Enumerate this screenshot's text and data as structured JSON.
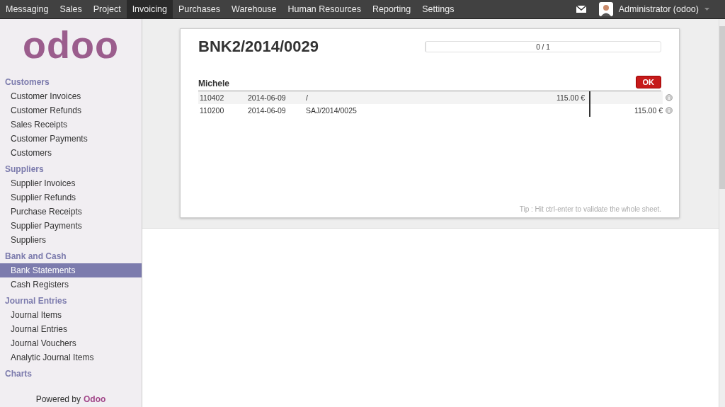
{
  "top_menu": [
    {
      "label": "Messaging",
      "selected": false
    },
    {
      "label": "Sales",
      "selected": false
    },
    {
      "label": "Project",
      "selected": false
    },
    {
      "label": "Invoicing",
      "selected": true
    },
    {
      "label": "Purchases",
      "selected": false
    },
    {
      "label": "Warehouse",
      "selected": false
    },
    {
      "label": "Human Resources",
      "selected": false
    },
    {
      "label": "Reporting",
      "selected": false
    },
    {
      "label": "Settings",
      "selected": false
    }
  ],
  "user": {
    "name": "Administrator (odoo)"
  },
  "logo": "odoo",
  "sidebar": [
    {
      "title": "Customers",
      "items": [
        {
          "label": "Customer Invoices",
          "selected": false
        },
        {
          "label": "Customer Refunds",
          "selected": false
        },
        {
          "label": "Sales Receipts",
          "selected": false
        },
        {
          "label": "Customer Payments",
          "selected": false
        },
        {
          "label": "Customers",
          "selected": false
        }
      ]
    },
    {
      "title": "Suppliers",
      "items": [
        {
          "label": "Supplier Invoices",
          "selected": false
        },
        {
          "label": "Supplier Refunds",
          "selected": false
        },
        {
          "label": "Purchase Receipts",
          "selected": false
        },
        {
          "label": "Supplier Payments",
          "selected": false
        },
        {
          "label": "Suppliers",
          "selected": false
        }
      ]
    },
    {
      "title": "Bank and Cash",
      "items": [
        {
          "label": "Bank Statements",
          "selected": true
        },
        {
          "label": "Cash Registers",
          "selected": false
        }
      ]
    },
    {
      "title": "Journal Entries",
      "items": [
        {
          "label": "Journal Items",
          "selected": false
        },
        {
          "label": "Journal Entries",
          "selected": false
        },
        {
          "label": "Journal Vouchers",
          "selected": false
        },
        {
          "label": "Analytic Journal Items",
          "selected": false
        }
      ]
    },
    {
      "title": "Charts"
    }
  ],
  "powered_by": {
    "text": "Powered by",
    "brand": "Odoo"
  },
  "statement": {
    "title": "BNK2/2014/0029",
    "progress": {
      "text": "0 / 1",
      "level": 0
    },
    "partner": "Michele",
    "ok_button": "OK",
    "lines": [
      {
        "account": "110402",
        "date": "2014-06-09",
        "reference": "/",
        "debit": "115.00 €",
        "highlighted": true
      },
      {
        "account": "110200",
        "date": "2014-06-09",
        "reference": "SAJ/2014/0025",
        "credit": "115.00 €",
        "highlighted": false
      }
    ],
    "tip": "Tip : Hit ctrl-enter to validate the whole sheet."
  }
}
